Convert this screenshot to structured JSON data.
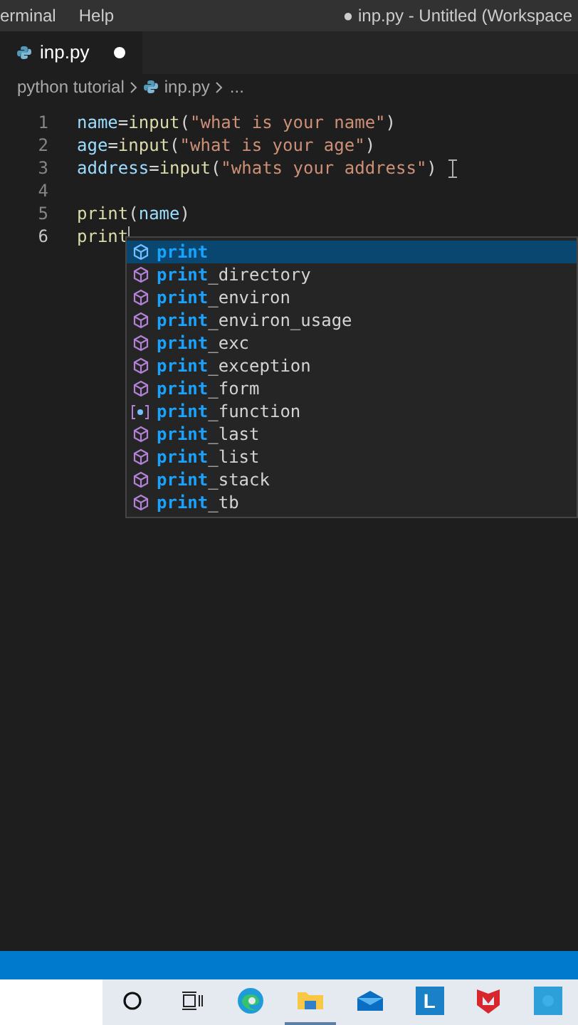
{
  "menu_bar": {
    "items": [
      "erminal",
      "Help"
    ],
    "title": "● inp.py - Untitled (Workspace"
  },
  "tabs": [
    {
      "label": "inp.py",
      "selected": true,
      "modified": true
    }
  ],
  "breadcrumb": [
    "python tutorial",
    "inp.py",
    "..."
  ],
  "editor": {
    "lines": [
      {
        "number": "1",
        "tokens": [
          {
            "kind": "variable",
            "text": "name"
          },
          {
            "kind": "plain",
            "text": "="
          },
          {
            "kind": "function",
            "text": "input"
          },
          {
            "kind": "plain",
            "text": "("
          },
          {
            "kind": "string",
            "text": "\"what is your name\""
          },
          {
            "kind": "plain",
            "text": ")"
          }
        ]
      },
      {
        "number": "2",
        "tokens": [
          {
            "kind": "variable",
            "text": "age"
          },
          {
            "kind": "plain",
            "text": "="
          },
          {
            "kind": "function",
            "text": "input"
          },
          {
            "kind": "plain",
            "text": "("
          },
          {
            "kind": "string",
            "text": "\"what is your age\""
          },
          {
            "kind": "plain",
            "text": ")"
          }
        ]
      },
      {
        "number": "3",
        "tokens": [
          {
            "kind": "variable",
            "text": "address"
          },
          {
            "kind": "plain",
            "text": "="
          },
          {
            "kind": "function",
            "text": "input"
          },
          {
            "kind": "plain",
            "text": "("
          },
          {
            "kind": "string",
            "text": "\"whats your address\""
          },
          {
            "kind": "plain",
            "text": ")"
          }
        ]
      },
      {
        "number": "4"
      },
      {
        "number": "5",
        "tokens": [
          {
            "kind": "function",
            "text": "print"
          },
          {
            "kind": "plain",
            "text": "("
          },
          {
            "kind": "variable",
            "text": "name"
          },
          {
            "kind": "plain",
            "text": ")"
          }
        ]
      },
      {
        "number": "6",
        "tokens": [
          {
            "kind": "function",
            "text": "print"
          }
        ],
        "caret": true
      }
    ]
  },
  "suggestions": [
    {
      "match": "print",
      "kind": "module",
      "selected": true
    },
    {
      "match": "print",
      "rest": "_directory",
      "kind": "module",
      "selected": false
    },
    {
      "match": "print",
      "rest": "_environ",
      "kind": "module",
      "selected": false
    },
    {
      "match": "print",
      "rest": "_environ_usage",
      "kind": "module",
      "selected": false
    },
    {
      "match": "print",
      "rest": "_exc",
      "kind": "module",
      "selected": false
    },
    {
      "match": "print",
      "rest": "_exception",
      "kind": "module",
      "selected": false
    },
    {
      "match": "print",
      "rest": "_form",
      "kind": "module",
      "selected": false
    },
    {
      "match": "print",
      "rest": "_function",
      "kind": "variable",
      "selected": false
    },
    {
      "match": "print",
      "rest": "_last",
      "kind": "module",
      "selected": false
    },
    {
      "match": "print",
      "rest": "_list",
      "kind": "module",
      "selected": false
    },
    {
      "match": "print",
      "rest": "_stack",
      "kind": "module",
      "selected": false
    },
    {
      "match": "print",
      "rest": "_tb",
      "kind": "module",
      "selected": false
    }
  ],
  "taskbar": [
    {
      "kind": "search"
    },
    {
      "kind": "taskview"
    },
    {
      "kind": "edge"
    },
    {
      "kind": "explorer",
      "selected": true
    },
    {
      "kind": "mail"
    },
    {
      "kind": "letter",
      "label": "L"
    },
    {
      "kind": "shield"
    },
    {
      "kind": "app"
    }
  ]
}
